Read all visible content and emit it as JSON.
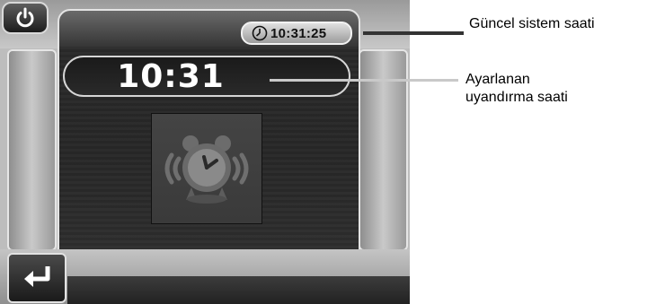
{
  "device": {
    "system_clock": "10:31:25",
    "alarm_time": "10:31",
    "icons": {
      "power": "power-icon",
      "clock": "clock-icon",
      "alarm": "alarm-clock-icon",
      "back": "back-arrow-icon"
    }
  },
  "annotations": {
    "system_time_label": "Güncel sistem saati",
    "alarm_time_label_line1": "Ayarlanan",
    "alarm_time_label_line2": "uyandırma saati"
  }
}
